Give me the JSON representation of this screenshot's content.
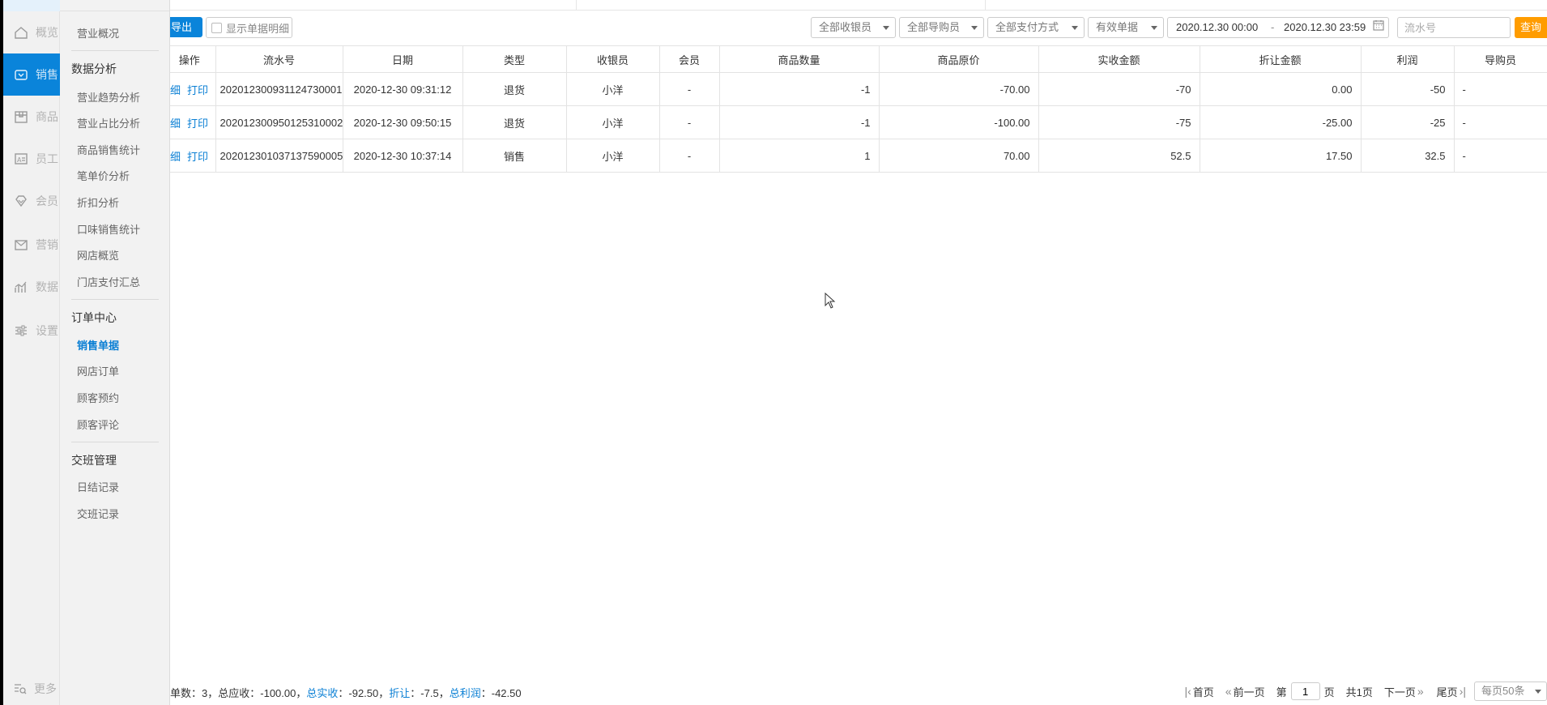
{
  "rail": {
    "items": [
      {
        "label": "概览",
        "icon": "home-icon",
        "active": false
      },
      {
        "label": "销售",
        "icon": "sales-icon",
        "active": true
      },
      {
        "label": "商品",
        "icon": "box-icon",
        "active": false
      },
      {
        "label": "员工",
        "icon": "id-card-icon",
        "active": false
      },
      {
        "label": "会员",
        "icon": "diamond-icon",
        "active": false
      },
      {
        "label": "营销",
        "icon": "mail-icon",
        "active": false
      },
      {
        "label": "数据",
        "icon": "chart-icon",
        "active": false
      },
      {
        "label": "设置",
        "icon": "sliders-icon",
        "active": false
      }
    ],
    "more_label": "更多"
  },
  "submenu": {
    "overview": "营业概况",
    "groups": [
      {
        "title": "数据分析",
        "items": [
          "营业趋势分析",
          "营业占比分析",
          "商品销售统计",
          "笔单价分析",
          "折扣分析",
          "口味销售统计",
          "网店概览",
          "门店支付汇总"
        ]
      },
      {
        "title": "订单中心",
        "items": [
          "销售单据",
          "网店订单",
          "顾客预约",
          "顾客评论"
        ]
      },
      {
        "title": "交班管理",
        "items": [
          "日结记录",
          "交班记录"
        ]
      }
    ],
    "active_item": "销售单据"
  },
  "toolbar": {
    "export_label": "导出",
    "show_detail_label": "显示单据明细",
    "cashier_select": "全部收银员",
    "guide_select": "全部导购员",
    "payment_select": "全部支付方式",
    "status_select": "有效单据",
    "date_start": "2020.12.30 00:00",
    "date_sep": "-",
    "date_end": "2020.12.30 23:59",
    "serial_placeholder": "流水号",
    "query_label": "查询"
  },
  "table": {
    "headers": [
      "操作",
      "流水号",
      "日期",
      "类型",
      "收银员",
      "会员",
      "商品数量",
      "商品原价",
      "实收金额",
      "折让金额",
      "利润",
      "导购员"
    ],
    "op_detail": "细",
    "op_print": "打印",
    "rows": [
      {
        "serial": "202012300931124730001",
        "date": "2020-12-30 09:31:12",
        "type": "退货",
        "cashier": "小洋",
        "member": "-",
        "qty": "-1",
        "orig_price": "-70.00",
        "received": "-70",
        "discount": "0.00",
        "profit": "-50",
        "guide": "-"
      },
      {
        "serial": "202012300950125310002",
        "date": "2020-12-30 09:50:15",
        "type": "退货",
        "cashier": "小洋",
        "member": "-",
        "qty": "-1",
        "orig_price": "-100.00",
        "received": "-75",
        "discount": "-25.00",
        "profit": "-25",
        "guide": "-"
      },
      {
        "serial": "202012301037137590005",
        "date": "2020-12-30 10:37:14",
        "type": "销售",
        "cashier": "小洋",
        "member": "-",
        "qty": "1",
        "orig_price": "70.00",
        "received": "52.5",
        "discount": "17.50",
        "profit": "32.5",
        "guide": "-"
      }
    ]
  },
  "footer": {
    "count_label": "单数：",
    "count_value": "3",
    "total_due_label": "，总应收：",
    "total_due_value": "-100.00",
    "total_received_label": "总实收",
    "total_received_value": "：-92.50",
    "discount_label": "折让",
    "discount_value": "：-7.5",
    "total_profit_label": "总利润",
    "total_profit_value": "：-42.50",
    "sep": "，"
  },
  "pager": {
    "first": "首页",
    "prev": "前一页",
    "page_prefix": "第",
    "page_value": "1",
    "page_suffix": "页",
    "total_pages": "共1页",
    "next": "下一页",
    "last": "尾页",
    "per_page": "每页50条"
  },
  "colors": {
    "accent": "#0a84da",
    "query": "#ff9c00",
    "link": "#0a7fd4"
  }
}
